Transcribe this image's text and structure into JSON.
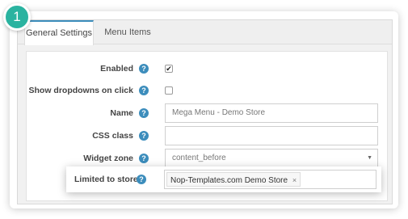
{
  "step_badge": "1",
  "tabs": [
    {
      "label": "General Settings",
      "active": true
    },
    {
      "label": "Menu Items",
      "active": false
    }
  ],
  "help_icon": "?",
  "checkmark": "✔",
  "fields": {
    "enabled": {
      "label": "Enabled",
      "checked": true
    },
    "show_dropdowns": {
      "label": "Show dropdowns on click",
      "checked": false
    },
    "name": {
      "label": "Name",
      "value": "Mega Menu - Demo Store"
    },
    "css_class": {
      "label": "CSS class",
      "value": ""
    },
    "widget_zone": {
      "label": "Widget zone",
      "value": "content_before",
      "arrow": "▼"
    },
    "limited_to_stores": {
      "label": "Limited to stores",
      "selected": [
        "Nop-Templates.com Demo Store"
      ],
      "remove_symbol": "×"
    }
  },
  "colors": {
    "accent": "#3c8dbc",
    "badge": "#2ab3a0"
  }
}
